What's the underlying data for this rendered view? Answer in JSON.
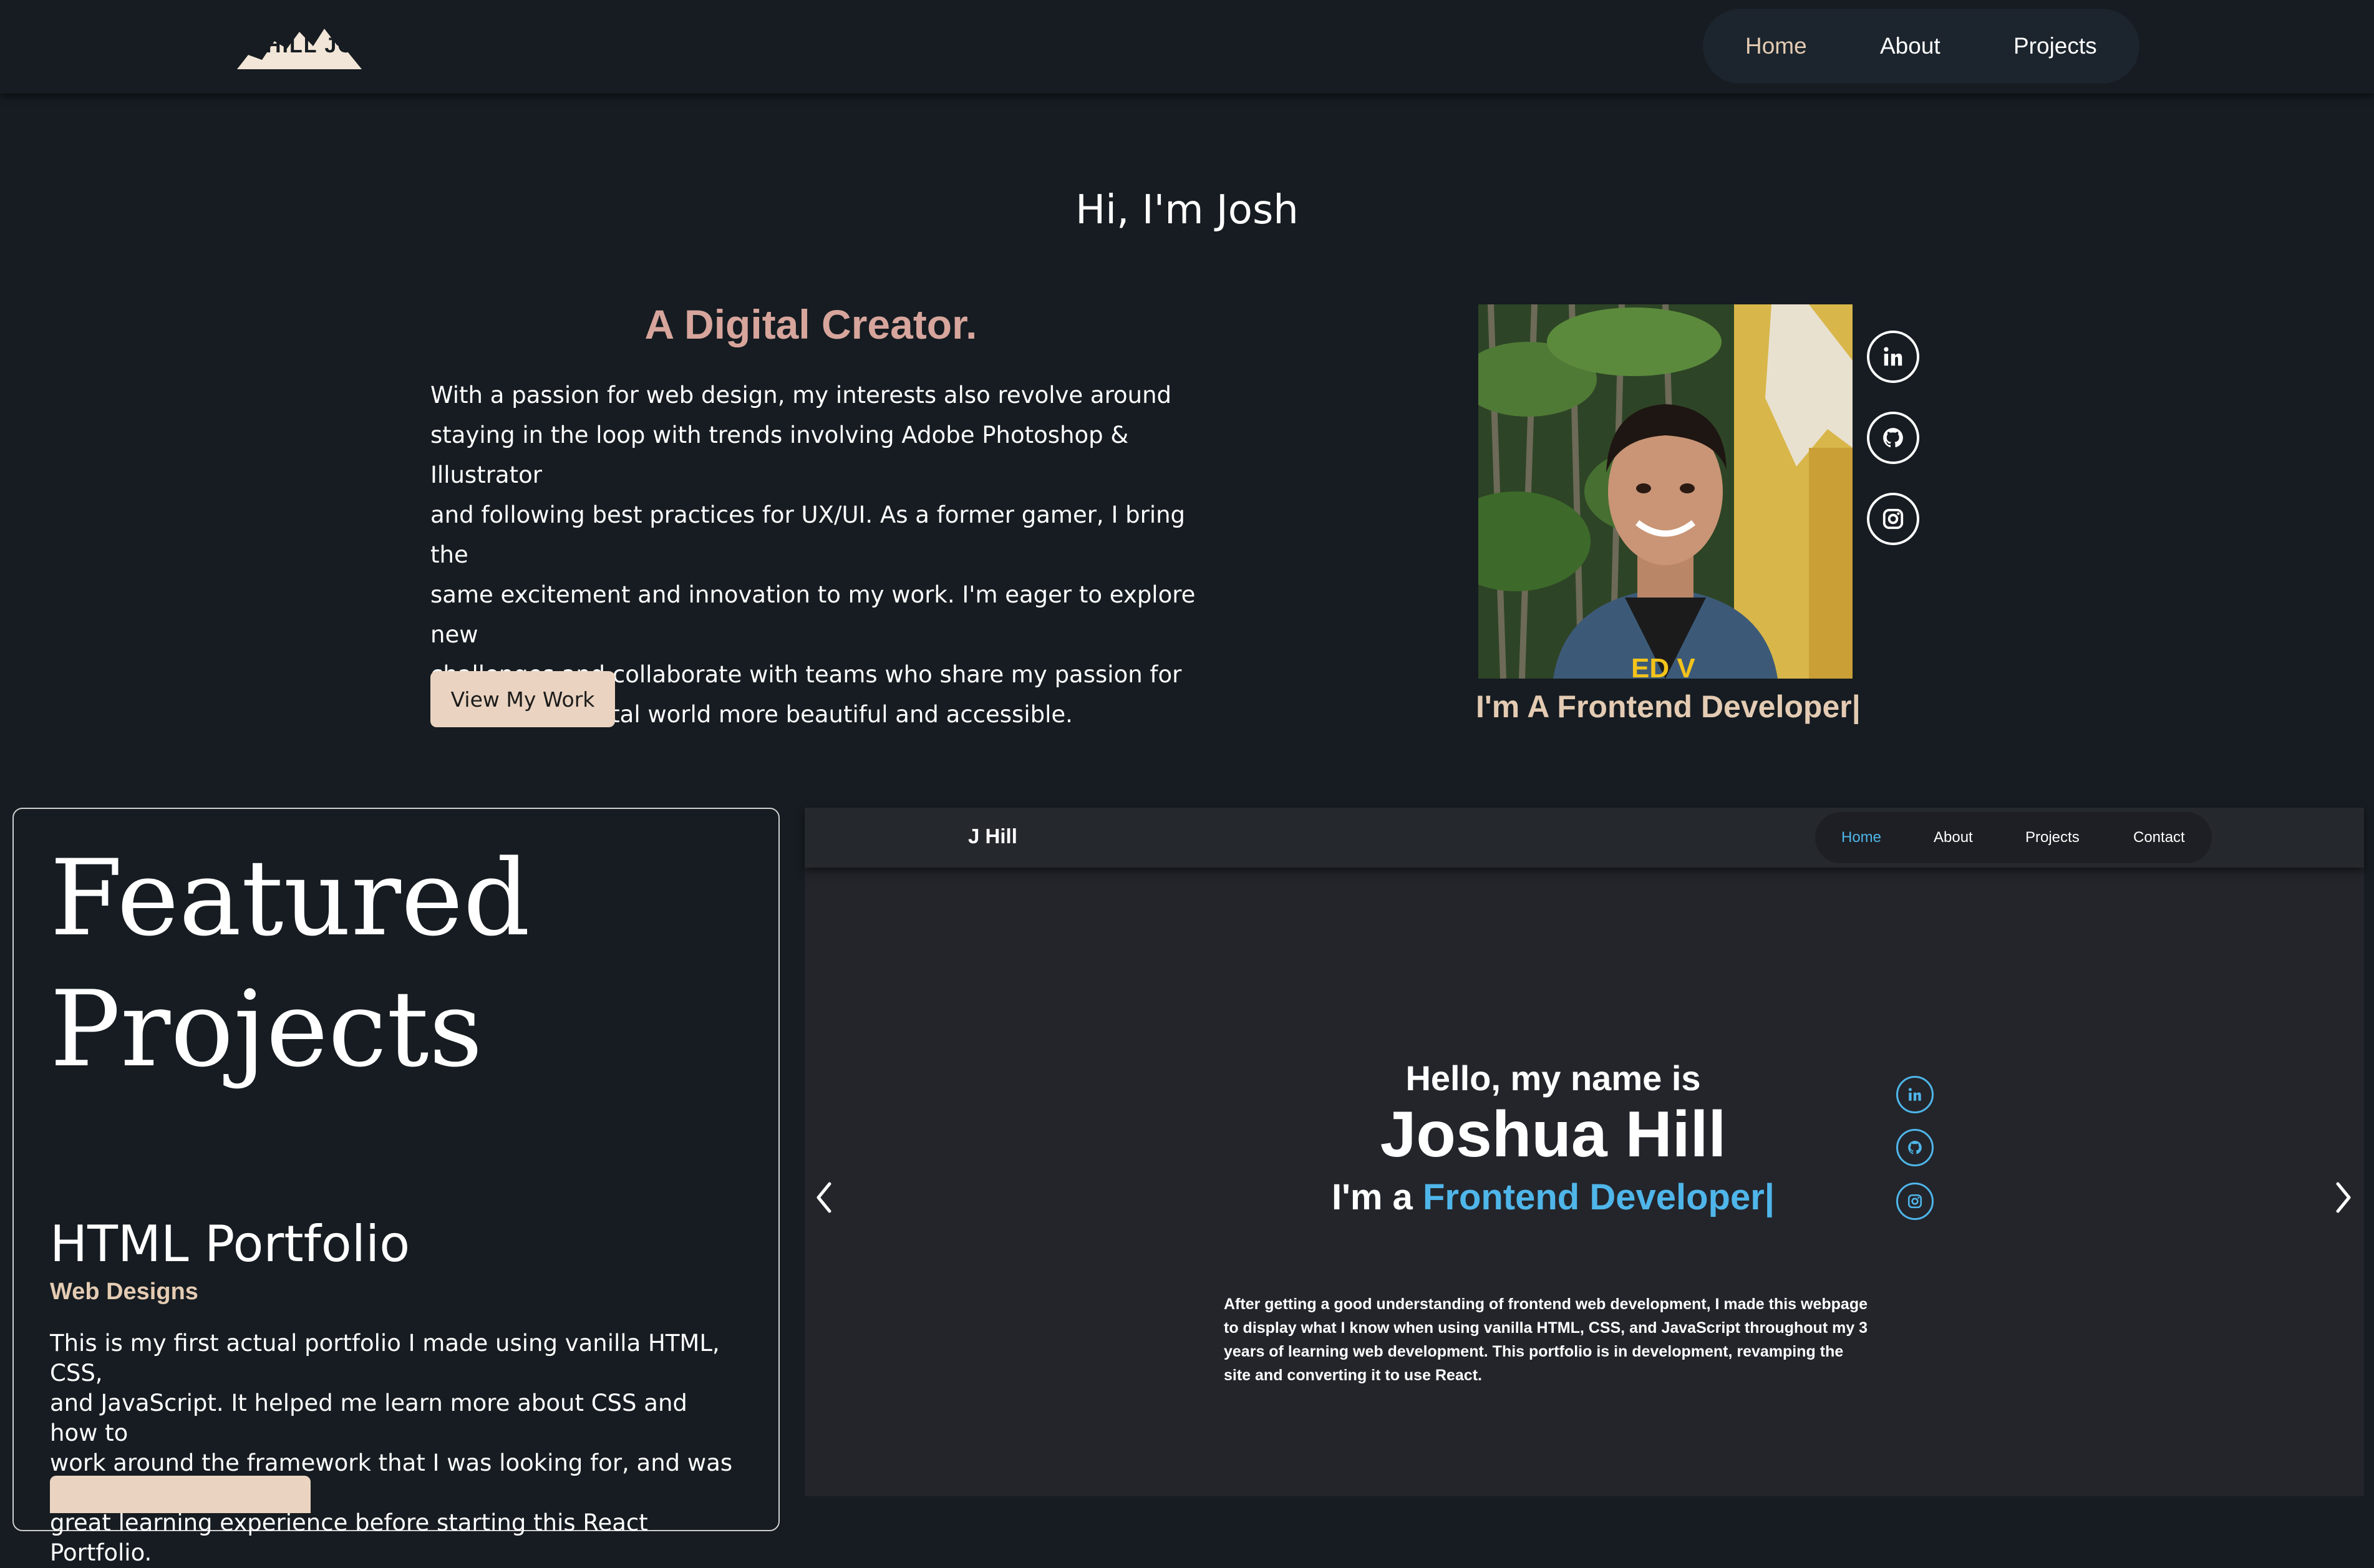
{
  "header": {
    "logo_text": "HILL JOSHUA",
    "nav": [
      {
        "label": "Home",
        "active": true
      },
      {
        "label": "About",
        "active": false
      },
      {
        "label": "Projects",
        "active": false
      }
    ]
  },
  "hero": {
    "greeting": "Hi, I'm Josh",
    "headline": "A Digital Creator.",
    "bio": [
      "With a passion for web design, my interests also revolve around",
      "staying in the loop with trends involving Adobe Photoshop & Illustrator",
      "and following best practices for UX/UI. As a former gamer, I bring the",
      "same excitement and innovation to my work. I'm eager to explore new",
      "challenges and collaborate with teams who share my passion for",
      "making the digital world more beautiful and accessible."
    ],
    "cta_label": "View My Work",
    "typed_text": "I'm A Frontend Developer|",
    "shirt_text": "ED V",
    "socials": [
      {
        "icon": "linkedin-icon"
      },
      {
        "icon": "github-icon"
      },
      {
        "icon": "instagram-icon"
      }
    ]
  },
  "featured": {
    "title_line1": "Featured",
    "title_line2": "Projects",
    "project_title": "HTML Portfolio",
    "project_subtitle": "Web Designs",
    "project_description": [
      "This is my first actual portfolio I made using vanilla HTML, CSS,",
      "and JavaScript. It helped me learn more about CSS and how to",
      "work around the framework that I was looking for, and was a",
      "great learning experience before starting this React Portfolio."
    ]
  },
  "preview": {
    "logo": "J Hill",
    "nav": [
      {
        "label": "Home",
        "active": true
      },
      {
        "label": "About",
        "active": false
      },
      {
        "label": "Projects",
        "active": false
      },
      {
        "label": "Contact",
        "active": false
      }
    ],
    "hello": "Hello, my name is",
    "name": "Joshua Hill",
    "role_prefix": "I'm a ",
    "role_accent": "Frontend Developer|",
    "description": [
      "After getting a good understanding of frontend web development, I made this webpage",
      "to display what I know when using vanilla HTML, CSS, and JavaScript throughout my 3",
      "years of learning web development. This portfolio is in development, revamping the",
      "site and converting it to use React."
    ],
    "socials": [
      {
        "icon": "linkedin-icon"
      },
      {
        "icon": "github-icon"
      },
      {
        "icon": "instagram-icon"
      }
    ]
  },
  "colors": {
    "background": "#161c21",
    "accent_rose": "#d7a59c",
    "accent_sand": "#e4cbb3",
    "button_fill": "#ead4c1",
    "preview_accent": "#4fb6ea"
  }
}
